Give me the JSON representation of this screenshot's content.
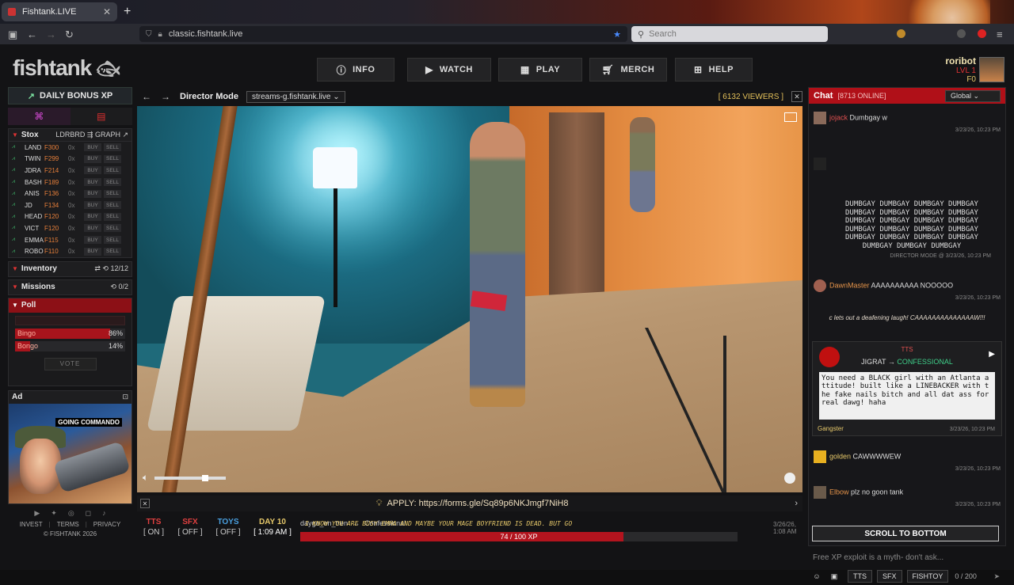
{
  "browser": {
    "tab_title": "Fishtank.LIVE",
    "url": "classic.fishtank.live",
    "search_placeholder": "Search"
  },
  "site": {
    "logo": "fishtank",
    "nav": [
      "INFO",
      "WATCH",
      "PLAY",
      "MERCH",
      "HELP"
    ],
    "user": {
      "name": "roribot",
      "level": "LVL 1",
      "fish": "F0"
    }
  },
  "left": {
    "daily_bonus": "DAILY BONUS XP",
    "stox": {
      "title": "Stox",
      "ldrbrd": "LDRBRD",
      "graph": "GRAPH",
      "buy": "BUY",
      "sell": "SELL",
      "items": [
        {
          "ticker": "LAND",
          "price": "F300",
          "qty": "0x"
        },
        {
          "ticker": "TWIN",
          "price": "F299",
          "qty": "0x"
        },
        {
          "ticker": "JDRA",
          "price": "F214",
          "qty": "0x"
        },
        {
          "ticker": "BASH",
          "price": "F189",
          "qty": "0x"
        },
        {
          "ticker": "ANIS",
          "price": "F136",
          "qty": "0x"
        },
        {
          "ticker": "JD",
          "price": "F134",
          "qty": "0x"
        },
        {
          "ticker": "HEAD",
          "price": "F120",
          "qty": "0x"
        },
        {
          "ticker": "VICT",
          "price": "F120",
          "qty": "0x"
        },
        {
          "ticker": "EMMA",
          "price": "F115",
          "qty": "0x"
        },
        {
          "ticker": "ROBO",
          "price": "F110",
          "qty": "0x"
        }
      ]
    },
    "inventory": {
      "title": "Inventory",
      "count": "12/12"
    },
    "missions": {
      "title": "Missions",
      "count": "0/2"
    },
    "poll": {
      "title": "Poll",
      "options": [
        {
          "label": "Bingo",
          "pct": "86%",
          "fraction": 0.86
        },
        {
          "label": "Bongo",
          "pct": "14%",
          "fraction": 0.14
        }
      ],
      "vote": "VOTE"
    },
    "ad": {
      "title": "Ad",
      "banner": "GOING COMMANDO"
    },
    "footer": {
      "invest": "INVEST",
      "terms": "TERMS",
      "privacy": "PRIVACY",
      "copyright": "© FISHTANK 2026"
    }
  },
  "video": {
    "mode": "Director Mode",
    "stream": "streams-g.fishtank.live",
    "viewers": "[ 6132 VIEWERS ]",
    "apply": "APPLY: https://forms.gle/Sq89p6NKJmgf7NiH8"
  },
  "controls": {
    "tts": {
      "label": "TTS",
      "value": "[ ON ]"
    },
    "sfx": {
      "label": "SFX",
      "value": "[ OFF ]"
    },
    "toys": {
      "label": "TOYS",
      "value": "[ OFF ]"
    },
    "day": {
      "label": "DAY 10",
      "value": "[ 1:09 AM ]"
    },
    "ticker": {
      "from": "daygo_on_tren",
      "to": "Confessional",
      "message": "I KNOW YOU ARE BUSY EMMA AND MAYBE YOUR MAGE BOYFRIEND IS DEAD. BUT GO",
      "time": "3/26/26, 1:08 AM"
    },
    "xp": {
      "text": "74 / 100 XP",
      "fraction": 0.74
    }
  },
  "chat": {
    "title": "Chat",
    "online": "[8713 ONLINE]",
    "channel": "Global",
    "messages": [
      {
        "user": "jojack",
        "text": "Dumbgay w",
        "time": "3/23/26, 10:23 PM"
      },
      {
        "user": "DawnMaster",
        "text": "AAAAAAAAAA NOOOOO",
        "time": "3/23/26, 10:23 PM"
      },
      {
        "user": "golden",
        "text": "CAWWWWEW",
        "time": "3/23/26, 10:23 PM"
      },
      {
        "user": "Elbow",
        "text": "plz no goon tank",
        "time": "3/23/26, 10:23 PM"
      }
    ],
    "spam": "DUMBGAY DUMBGAY DUMBGAY DUMBGAY DUMBGAY DUMBGAY DUMBGAY DUMBGAY DUMBGAY DUMBGAY DUMBGAY DUMBGAY DUMBGAY DUMBGAY DUMBGAY DUMBGAY DUMBGAY DUMBGAY DUMBGAY DUMBGAY DUMBGAY DUMBGAY DUMBGAY",
    "spam_meta": "DIRECTOR MODE @ 3/23/26, 10:23 PM",
    "action": "c lets out a deafening laugh! CAAAAAAAAAAAAAAW!!!",
    "tts_card": {
      "label": "TTS",
      "from": "JIGRAT",
      "to": "CONFESSIONAL",
      "body": "You need a BLACK girl with an Atlanta attitude! built like a LINEBACKER with the fake nails bitch and all dat ass for real dawg! haha",
      "voice": "Gangster",
      "time": "3/23/26, 10:23 PM"
    },
    "scroll_bottom": "SCROLL TO BOTTOM",
    "input_placeholder": "Free XP exploit is a myth- don't ask...",
    "btn_tts": "TTS",
    "btn_sfx": "SFX",
    "btn_fishtoy": "FISHTOY",
    "char_count": "0 / 200"
  },
  "colors": {
    "accent_red": "#b01018",
    "gold": "#e6c86a",
    "green": "#3fcf8a"
  }
}
